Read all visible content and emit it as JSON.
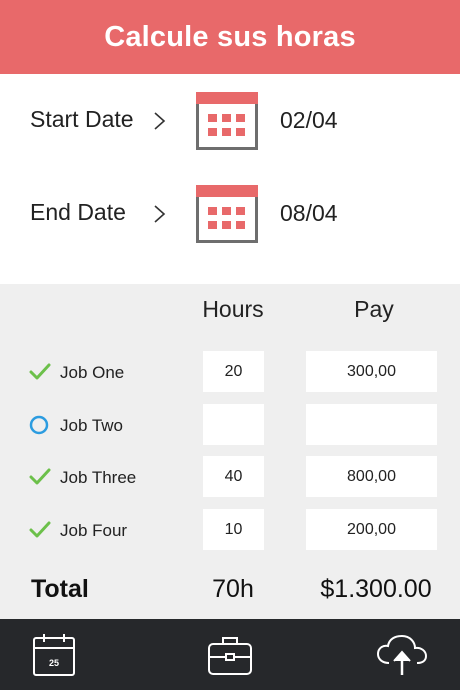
{
  "header": {
    "title": "Calcule sus horas"
  },
  "dates": {
    "start": {
      "label": "Start Date",
      "value": "02/04"
    },
    "end": {
      "label": "End Date",
      "value": "08/04"
    }
  },
  "table": {
    "columns": {
      "hours": "Hours",
      "pay": "Pay"
    },
    "jobs": [
      {
        "name": "Job One",
        "status": "checked",
        "hours": "20",
        "pay": "300,00"
      },
      {
        "name": "Job Two",
        "status": "unchecked",
        "hours": "",
        "pay": ""
      },
      {
        "name": "Job Three",
        "status": "checked",
        "hours": "40",
        "pay": "800,00"
      },
      {
        "name": "Job Four",
        "status": "checked",
        "hours": "10",
        "pay": "200,00"
      }
    ],
    "total": {
      "label": "Total",
      "hours": "70h",
      "pay": "$1.300.00"
    }
  },
  "tabbar": {
    "calendar_day": "25",
    "icons": [
      "calendar-icon",
      "briefcase-icon",
      "cloud-upload-icon"
    ]
  },
  "colors": {
    "accent": "#e8696a",
    "check": "#6cc04a",
    "radio": "#2c9ce0",
    "tabbar": "#26282b",
    "panel": "#efefef"
  }
}
